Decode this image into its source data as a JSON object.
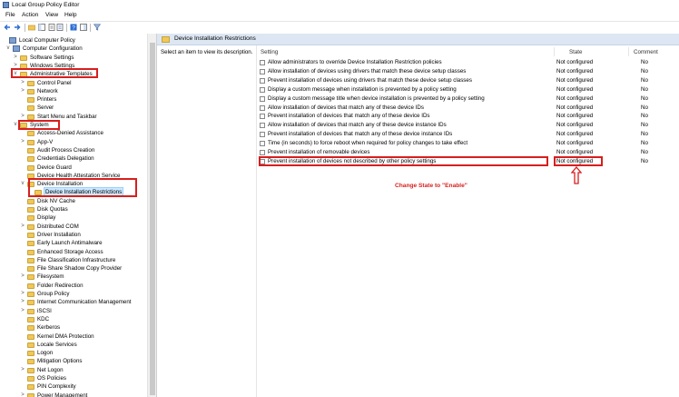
{
  "window": {
    "title": "Local Group Policy Editor"
  },
  "menu": [
    "File",
    "Action",
    "View",
    "Help"
  ],
  "toolbar": {
    "buttons": [
      "back-icon",
      "forward-icon",
      "up-folder-icon",
      "show-hide-tree-icon",
      "properties-icon",
      "export-list-icon",
      "help-icon",
      "extended-view-icon",
      "filter-icon"
    ]
  },
  "tree": {
    "nodes": [
      {
        "label": "Local Computer Policy",
        "icon": "pc"
      },
      {
        "label": "Computer Configuration",
        "icon": "pc",
        "expander": "v"
      },
      {
        "label": "Software Settings",
        "icon": "folder",
        "expander": ">"
      },
      {
        "label": "Windows Settings",
        "icon": "folder",
        "expander": ">"
      },
      {
        "label": "Administrative Templates",
        "icon": "folder",
        "expander": "v"
      },
      {
        "label": "Control Panel",
        "icon": "folder",
        "expander": ">"
      },
      {
        "label": "Network",
        "icon": "folder",
        "expander": ">"
      },
      {
        "label": "Printers",
        "icon": "folder",
        "expander": ""
      },
      {
        "label": "Server",
        "icon": "folder",
        "expander": ""
      },
      {
        "label": "Start Menu and Taskbar",
        "icon": "folder",
        "expander": ">"
      },
      {
        "label": "System",
        "icon": "folder",
        "expander": "v"
      },
      {
        "label": "Access-Denied Assistance",
        "icon": "folder",
        "expander": ""
      },
      {
        "label": "App-V",
        "icon": "folder",
        "expander": ">"
      },
      {
        "label": "Audit Process Creation",
        "icon": "folder",
        "expander": ""
      },
      {
        "label": "Credentials Delegation",
        "icon": "folder",
        "expander": ""
      },
      {
        "label": "Device Guard",
        "icon": "folder",
        "expander": ""
      },
      {
        "label": "Device Health Attestation Service",
        "icon": "folder",
        "expander": ""
      },
      {
        "label": "Device Installation",
        "icon": "folder",
        "expander": "v"
      },
      {
        "label": "Device Installation Restrictions",
        "icon": "folder",
        "expander": "",
        "selected": true
      },
      {
        "label": "Disk NV Cache",
        "icon": "folder",
        "expander": ""
      },
      {
        "label": "Disk Quotas",
        "icon": "folder",
        "expander": ""
      },
      {
        "label": "Display",
        "icon": "folder",
        "expander": ""
      },
      {
        "label": "Distributed COM",
        "icon": "folder",
        "expander": ">"
      },
      {
        "label": "Driver Installation",
        "icon": "folder",
        "expander": ""
      },
      {
        "label": "Early Launch Antimalware",
        "icon": "folder",
        "expander": ""
      },
      {
        "label": "Enhanced Storage Access",
        "icon": "folder",
        "expander": ""
      },
      {
        "label": "File Classification Infrastructure",
        "icon": "folder",
        "expander": ""
      },
      {
        "label": "File Share Shadow Copy Provider",
        "icon": "folder",
        "expander": ""
      },
      {
        "label": "Filesystem",
        "icon": "folder",
        "expander": ">"
      },
      {
        "label": "Folder Redirection",
        "icon": "folder",
        "expander": ""
      },
      {
        "label": "Group Policy",
        "icon": "folder",
        "expander": ">"
      },
      {
        "label": "Internet Communication Management",
        "icon": "folder",
        "expander": ">"
      },
      {
        "label": "iSCSI",
        "icon": "folder",
        "expander": ">"
      },
      {
        "label": "KDC",
        "icon": "folder",
        "expander": ""
      },
      {
        "label": "Kerberos",
        "icon": "folder",
        "expander": ""
      },
      {
        "label": "Kernel DMA Protection",
        "icon": "folder",
        "expander": ""
      },
      {
        "label": "Locale Services",
        "icon": "folder",
        "expander": ""
      },
      {
        "label": "Logon",
        "icon": "folder",
        "expander": ""
      },
      {
        "label": "Mitigation Options",
        "icon": "folder",
        "expander": ""
      },
      {
        "label": "Net Logon",
        "icon": "folder",
        "expander": ">"
      },
      {
        "label": "OS Policies",
        "icon": "folder",
        "expander": ""
      },
      {
        "label": "PIN Complexity",
        "icon": "folder",
        "expander": ""
      },
      {
        "label": "Power Management",
        "icon": "folder",
        "expander": ">"
      }
    ]
  },
  "details": {
    "header": "Device Installation Restrictions",
    "description_prompt": "Select an item to view its description.",
    "columns": {
      "setting": "Setting",
      "state": "State",
      "comment": "Comment"
    },
    "rows": [
      {
        "setting": "Allow administrators to override Device Installation Restriction policies",
        "state": "Not configured",
        "comment": "No"
      },
      {
        "setting": "Allow installation of devices using drivers that match these device setup classes",
        "state": "Not configured",
        "comment": "No"
      },
      {
        "setting": "Prevent installation of devices using drivers that match these device setup classes",
        "state": "Not configured",
        "comment": "No"
      },
      {
        "setting": "Display a custom message when installation is prevented by a policy setting",
        "state": "Not configured",
        "comment": "No"
      },
      {
        "setting": "Display a custom message title when device installation is prevented by a policy setting",
        "state": "Not configured",
        "comment": "No"
      },
      {
        "setting": "Allow installation of devices that match any of these device IDs",
        "state": "Not configured",
        "comment": "No"
      },
      {
        "setting": "Prevent installation of devices that match any of these device IDs",
        "state": "Not configured",
        "comment": "No"
      },
      {
        "setting": "Allow installation of devices that match any of these device instance IDs",
        "state": "Not configured",
        "comment": "No"
      },
      {
        "setting": "Prevent installation of devices that match any of these device instance IDs",
        "state": "Not configured",
        "comment": "No"
      },
      {
        "setting": "Time (in seconds) to force reboot when required for policy changes to take effect",
        "state": "Not configured",
        "comment": "No"
      },
      {
        "setting": "Prevent installation of removable devices",
        "state": "Not configured",
        "comment": "No"
      },
      {
        "setting": "Prevent installation of devices not described by other policy settings",
        "state": "Not configured",
        "comment": "No"
      }
    ]
  },
  "annotation": {
    "text": "Change State to \"Enable\"",
    "color": "#d81e1e"
  }
}
